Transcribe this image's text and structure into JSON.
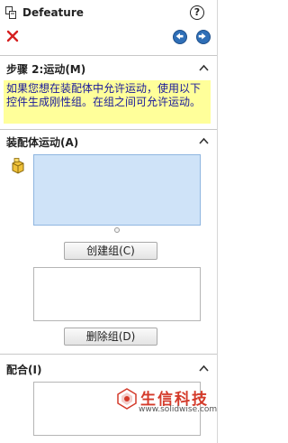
{
  "titlebar": {
    "title": "Defeature",
    "help_label": "?"
  },
  "actions": {
    "close_label": "×"
  },
  "step_section": {
    "title": "步骤 2:运动(M)",
    "message": "如果您想在装配体中允许运动，使用以下控件生成刚性组。在组之间可允许运动。"
  },
  "assembly_motion": {
    "title": "装配体运动(A)",
    "create_group_label": "创建组(C)",
    "delete_group_label": "删除组(D)"
  },
  "mates": {
    "title": "配合(I)"
  },
  "watermark": {
    "brand": "生信科技",
    "url": "www.solidwise.com"
  },
  "colors": {
    "accent_blue": "#2f6fb7",
    "message_bg": "#ffff9a",
    "message_text": "#1a1a9a",
    "close_red": "#d62020",
    "list_selected_bg": "#cfe3f8",
    "watermark_red": "#d43a2a"
  }
}
